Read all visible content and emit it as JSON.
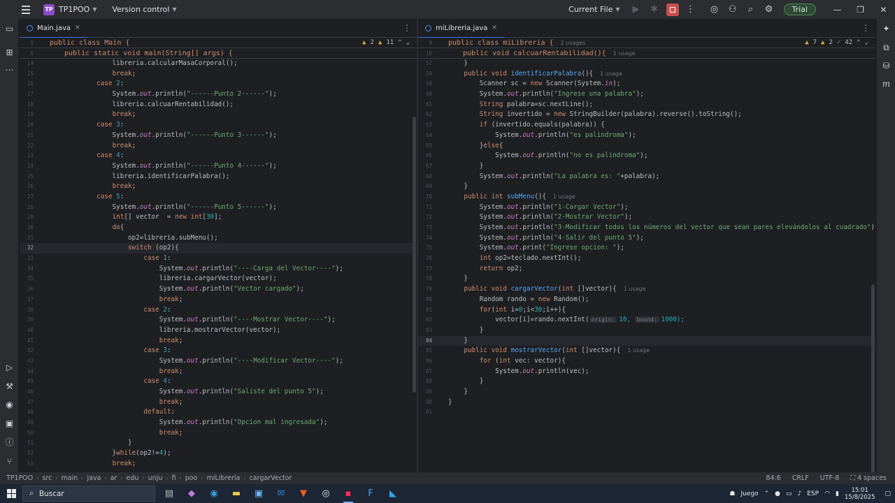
{
  "titlebar": {
    "project_badge": "TP",
    "project_name": "TP1POO",
    "vcs": "Version control",
    "run_config": "Current File",
    "trial": "Trial"
  },
  "left_editor": {
    "tab": "Main.java",
    "sticky_line_no": "5",
    "sticky_1": "public class Main {",
    "sticky_2_no": "6",
    "sticky_2": "public static void main(String[] args) {",
    "warnings": "2",
    "weak_warnings": "11"
  },
  "right_editor": {
    "tab": "miLibreria.java",
    "sticky_line_no": "9",
    "sticky_1": "public class miLibreria {",
    "sticky_usages": "2 usages",
    "sticky_2_no": "10",
    "sticky_2": "public void calcuarRentabilidad(){",
    "sticky_2_usage": "1 usage",
    "warnings": "7",
    "weak_warnings": "2",
    "typos": "42"
  },
  "left_lines": [
    {
      "n": "14",
      "t": "                libreria.calcularMasaCorporal();"
    },
    {
      "n": "15",
      "t": "                break;"
    },
    {
      "n": "16",
      "t": "            case 2:"
    },
    {
      "n": "17",
      "t": "                System.out.println(\"------Punto 2------\");"
    },
    {
      "n": "18",
      "t": "                libreria.calcuarRentabilidad();"
    },
    {
      "n": "19",
      "t": "                break;"
    },
    {
      "n": "20",
      "t": "            case 3:"
    },
    {
      "n": "21",
      "t": "                System.out.println(\"------Punto 3------\");"
    },
    {
      "n": "22",
      "t": "                break;"
    },
    {
      "n": "23",
      "t": "            case 4:"
    },
    {
      "n": "24",
      "t": "                System.out.println(\"------Punto 4------\");"
    },
    {
      "n": "25",
      "t": "                libreria.identificarPalabra();"
    },
    {
      "n": "26",
      "t": "                break;"
    },
    {
      "n": "27",
      "t": "            case 5:"
    },
    {
      "n": "28",
      "t": "                System.out.println(\"------Punto 5------\");"
    },
    {
      "n": "29",
      "t": "                int[] vector  = new int[30];"
    },
    {
      "n": "30",
      "t": "                do{"
    },
    {
      "n": "31",
      "t": "                    op2=libreria.subMenu();"
    },
    {
      "n": "32",
      "t": "                    switch (op2){"
    },
    {
      "n": "33",
      "t": "                        case 1:"
    },
    {
      "n": "34",
      "t": "                            System.out.println(\"----Carga del Vector----\");"
    },
    {
      "n": "35",
      "t": "                            libreria.cargarVector(vector);"
    },
    {
      "n": "36",
      "t": "                            System.out.println(\"Vector cargado\");"
    },
    {
      "n": "37",
      "t": "                            break;"
    },
    {
      "n": "38",
      "t": "                        case 2:"
    },
    {
      "n": "39",
      "t": "                            System.out.println(\"----Mostrar Vector----\");"
    },
    {
      "n": "40",
      "t": "                            libreria.mostrarVector(vector);"
    },
    {
      "n": "41",
      "t": "                            break;"
    },
    {
      "n": "42",
      "t": "                        case 3:"
    },
    {
      "n": "43",
      "t": "                            System.out.println(\"----Modificar Vector----\");"
    },
    {
      "n": "44",
      "t": "                            break;"
    },
    {
      "n": "45",
      "t": "                        case 4:"
    },
    {
      "n": "46",
      "t": "                            System.out.println(\"Saliste del punto 5\");"
    },
    {
      "n": "47",
      "t": "                            break;"
    },
    {
      "n": "48",
      "t": "                        default:"
    },
    {
      "n": "49",
      "t": "                            System.out.println(\"Opcion mal ingresada\");"
    },
    {
      "n": "50",
      "t": "                            break;"
    },
    {
      "n": "51",
      "t": "                    }"
    },
    {
      "n": "52",
      "t": "                }while(op2!=4);"
    },
    {
      "n": "53",
      "t": "                break;"
    }
  ],
  "right_lines": [
    {
      "n": "57",
      "t": "    }"
    },
    {
      "n": "58",
      "t": "    public void identificarPalabra(){",
      "u": "1 usage"
    },
    {
      "n": "59",
      "t": "        Scanner sc = new Scanner(System.in);"
    },
    {
      "n": "60",
      "t": "        System.out.println(\"Ingrese una palabra\");"
    },
    {
      "n": "61",
      "t": "        String palabra=sc.nextLine();"
    },
    {
      "n": "62",
      "t": "        String invertido = new StringBuilder(palabra).reverse().toString();"
    },
    {
      "n": "63",
      "t": "        if (invertido.equals(palabra)) {"
    },
    {
      "n": "64",
      "t": "            System.out.println(\"es palindroma\");"
    },
    {
      "n": "65",
      "t": "        }else{"
    },
    {
      "n": "66",
      "t": "            System.out.println(\"no es palindroma\");"
    },
    {
      "n": "67",
      "t": "        }"
    },
    {
      "n": "68",
      "t": "        System.out.println(\"La palabra es: \"+palabra);"
    },
    {
      "n": "69",
      "t": "    }"
    },
    {
      "n": "70",
      "t": "    public int subMenu(){",
      "u": "1 usage"
    },
    {
      "n": "71",
      "t": "        System.out.println(\"1-Cargar Vector\");"
    },
    {
      "n": "72",
      "t": "        System.out.println(\"2-Mostrar Vector\");"
    },
    {
      "n": "73",
      "t": "        System.out.println(\"3-Modificar todos los números del vector que sean pares elevándolos al cuadrado\");"
    },
    {
      "n": "74",
      "t": "        System.out.println(\"4-Salir del punto 5\");"
    },
    {
      "n": "75",
      "t": "        System.out.print(\"Ingrese opcion: \");"
    },
    {
      "n": "76",
      "t": "        int op2=teclado.nextInt();"
    },
    {
      "n": "77",
      "t": "        return op2;"
    },
    {
      "n": "78",
      "t": "    }"
    },
    {
      "n": "79",
      "t": "    public void cargarVector(int []vector){",
      "u": "1 usage"
    },
    {
      "n": "80",
      "t": "        Random rando = new Random();"
    },
    {
      "n": "81",
      "t": "        for(int i=0;i<30;i++){"
    },
    {
      "n": "82",
      "t": "            vector[i]=rando.nextInt(",
      "h1": "origin:",
      "a1": "10,",
      "h2": "bound:",
      "a2": "1000);"
    },
    {
      "n": "83",
      "t": "        }"
    },
    {
      "n": "84",
      "t": "    }"
    },
    {
      "n": "85",
      "t": "    public void mostrarVector(int []vector){",
      "u": "1 usage"
    },
    {
      "n": "86",
      "t": "        for (int vec: vector){"
    },
    {
      "n": "87",
      "t": "            System.out.println(vec);"
    },
    {
      "n": "88",
      "t": "        }"
    },
    {
      "n": "89",
      "t": "    }"
    },
    {
      "n": "90",
      "t": "}"
    },
    {
      "n": "91",
      "t": ""
    }
  ],
  "breadcrumb": [
    "TP1POO",
    "src",
    "main",
    "java",
    "ar",
    "edu",
    "unju",
    "fi",
    "poo",
    "miLibreria",
    "cargarVector"
  ],
  "status": {
    "position": "84:6",
    "line_sep": "CRLF",
    "encoding": "UTF-8",
    "indent": "4 spaces"
  },
  "taskbar": {
    "search": "Buscar",
    "weather": "Juego",
    "lang": "ESP",
    "time": "15:01",
    "date": "15/8/2025"
  }
}
